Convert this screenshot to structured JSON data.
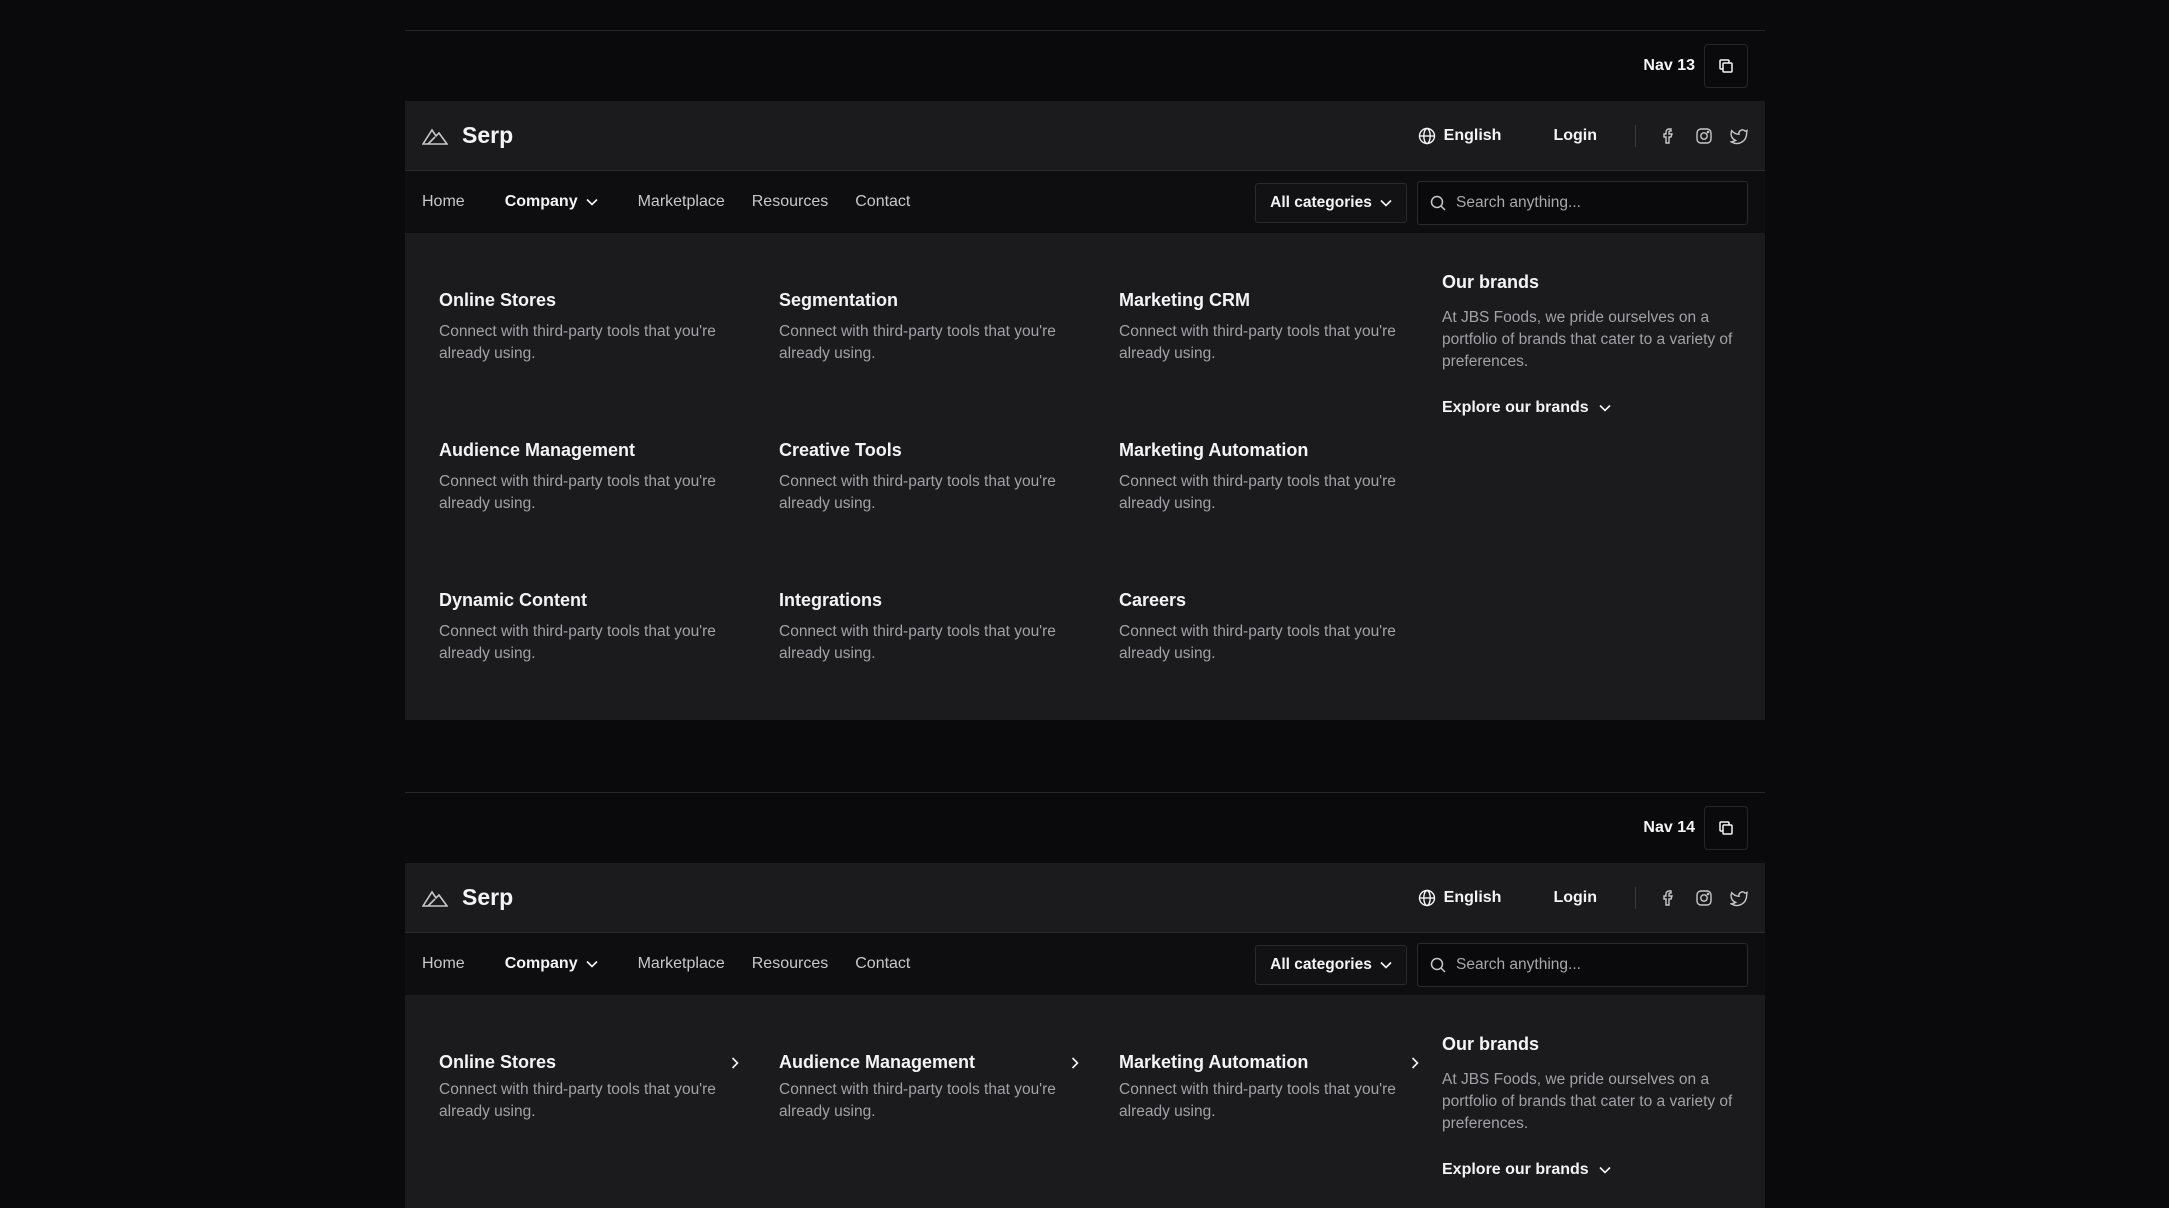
{
  "nav13": {
    "label": "Nav 13",
    "logo_text": "Serp",
    "language": "English",
    "login": "Login",
    "nav": [
      "Home",
      "Company",
      "Marketplace",
      "Resources",
      "Contact"
    ],
    "category_select": "All categories",
    "search_placeholder": "Search anything...",
    "items": [
      {
        "title": "Online Stores",
        "desc": "Connect with third-party tools that you're already using."
      },
      {
        "title": "Segmentation",
        "desc": "Connect with third-party tools that you're already using."
      },
      {
        "title": "Marketing CRM",
        "desc": "Connect with third-party tools that you're already using."
      },
      {
        "title": "Audience Management",
        "desc": "Connect with third-party tools that you're already using."
      },
      {
        "title": "Creative Tools",
        "desc": "Connect with third-party tools that you're already using."
      },
      {
        "title": "Marketing Automation",
        "desc": "Connect with third-party tools that you're already using."
      },
      {
        "title": "Dynamic Content",
        "desc": "Connect with third-party tools that you're already using."
      },
      {
        "title": "Integrations",
        "desc": "Connect with third-party tools that you're already using."
      },
      {
        "title": "Careers",
        "desc": "Connect with third-party tools that you're already using."
      }
    ],
    "brands": {
      "title": "Our brands",
      "desc": "At JBS Foods, we pride ourselves on a portfolio of brands that cater to a variety of preferences.",
      "explore": "Explore our brands"
    }
  },
  "nav14": {
    "label": "Nav 14",
    "logo_text": "Serp",
    "language": "English",
    "login": "Login",
    "nav": [
      "Home",
      "Company",
      "Marketplace",
      "Resources",
      "Contact"
    ],
    "category_select": "All categories",
    "search_placeholder": "Search anything...",
    "items": [
      {
        "title": "Online Stores",
        "desc": "Connect with third-party tools that you're already using."
      },
      {
        "title": "Audience Management",
        "desc": "Connect with third-party tools that you're already using."
      },
      {
        "title": "Marketing Automation",
        "desc": "Connect with third-party tools that you're already using."
      }
    ],
    "brands": {
      "title": "Our brands",
      "desc": "At JBS Foods, we pride ourselves on a portfolio of brands that cater to a variety of preferences.",
      "explore": "Explore our brands"
    }
  }
}
